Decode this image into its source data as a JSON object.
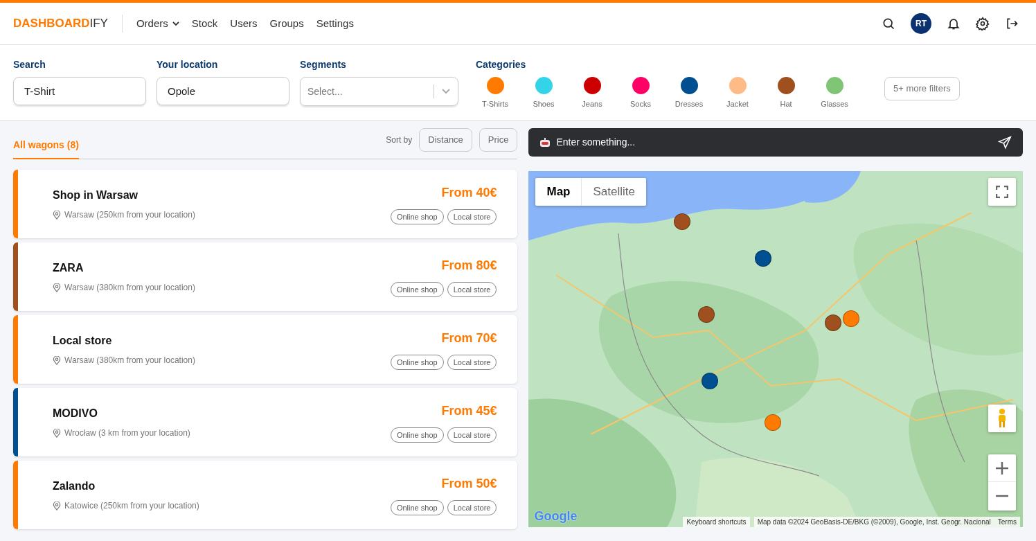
{
  "header": {
    "logo_bold": "DASHBOARD",
    "logo_rest": "IFY",
    "nav": [
      {
        "label": "Orders",
        "dropdown": true
      },
      {
        "label": "Stock",
        "dropdown": false
      },
      {
        "label": "Users",
        "dropdown": false
      },
      {
        "label": "Groups",
        "dropdown": false
      },
      {
        "label": "Settings",
        "dropdown": false
      }
    ],
    "avatar": "RT"
  },
  "filters": {
    "search": {
      "label": "Search",
      "value": "T-Shirt"
    },
    "location": {
      "label": "Your location",
      "value": "Opole"
    },
    "segments": {
      "label": "Segments",
      "placeholder": "Select..."
    },
    "categories_label": "Categories",
    "categories": [
      {
        "label": "T-Shirts",
        "color": "#ff7a00"
      },
      {
        "label": "Shoes",
        "color": "#33d4e8"
      },
      {
        "label": "Jeans",
        "color": "#cc0000"
      },
      {
        "label": "Socks",
        "color": "#ff0066"
      },
      {
        "label": "Dresses",
        "color": "#004f91"
      },
      {
        "label": "Jacket",
        "color": "#ffbb85"
      },
      {
        "label": "Hat",
        "color": "#a0501f"
      },
      {
        "label": "Glasses",
        "color": "#80c575"
      }
    ],
    "more_filters": "5+ more filters"
  },
  "list": {
    "tab": "All wagons (8)",
    "sort_label": "Sort by",
    "sort_options": [
      "Distance",
      "Price"
    ],
    "cards": [
      {
        "title": "Shop in Warsaw",
        "location": "Warsaw (250km from your location)",
        "price": "From 40€",
        "tags": [
          "Online shop",
          "Local store"
        ],
        "color": "#ff7a00"
      },
      {
        "title": "ZARA",
        "location": "Warsaw (380km from your location)",
        "price": "From 80€",
        "tags": [
          "Online shop",
          "Local store"
        ],
        "color": "#a0501f"
      },
      {
        "title": "Local store",
        "location": "Warsaw (380km from your location)",
        "price": "From 70€",
        "tags": [
          "Online shop",
          "Local store"
        ],
        "color": "#ff7a00"
      },
      {
        "title": "MODIVO",
        "location": "Wrocław (3 km from your location)",
        "price": "From 45€",
        "tags": [
          "Online shop",
          "Local store"
        ],
        "color": "#004f91"
      },
      {
        "title": "Zalando",
        "location": "Katowice (250km from your location)",
        "price": "From 50€",
        "tags": [
          "Online shop",
          "Local store"
        ],
        "color": "#ff7a00"
      }
    ]
  },
  "assistant": {
    "placeholder": "Enter something..."
  },
  "map": {
    "tabs": [
      {
        "label": "Map",
        "selected": true
      },
      {
        "label": "Satellite",
        "selected": false
      }
    ],
    "markers": [
      {
        "color": "#a0501f"
      },
      {
        "color": "#004f91"
      },
      {
        "color": "#a0501f"
      },
      {
        "color": "#ff7a00"
      },
      {
        "color": "#a0501f"
      },
      {
        "color": "#004f91"
      },
      {
        "color": "#ff7a00"
      }
    ],
    "google": "Google",
    "shortcuts": "Keyboard shortcuts",
    "attribution": "Map data ©2024 GeoBasis-DE/BKG (©2009), Google, Inst. Geogr. Nacional",
    "terms": "Terms"
  }
}
